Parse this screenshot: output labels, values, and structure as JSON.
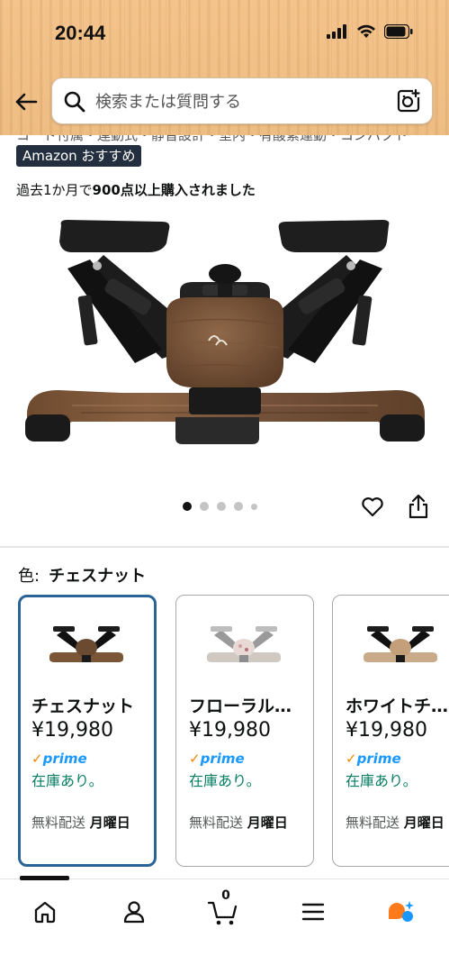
{
  "status_bar": {
    "time": "20:44"
  },
  "search": {
    "placeholder": "検索または質問する"
  },
  "cut_text": "コード付属・連動式・静音設計・室内・有酸素運動・コンパクト",
  "badge": {
    "label": "Amazon おすすめ"
  },
  "purchase": {
    "prefix": "過去1か月で",
    "bold": "900点以上購入されました"
  },
  "carousel": {
    "total": 5,
    "active": 0
  },
  "color": {
    "label": "色:",
    "value": "チェスナット"
  },
  "variants": [
    {
      "name": "チェスナット",
      "price": "¥19,980",
      "prime": "prime",
      "stock": "在庫あり。",
      "ship_label": "無料配送",
      "ship_day": "月曜日",
      "selected": true
    },
    {
      "name": "フローラル…",
      "price": "¥19,980",
      "prime": "prime",
      "stock": "在庫あり。",
      "ship_label": "無料配送",
      "ship_day": "月曜日",
      "selected": false
    },
    {
      "name": "ホワイトチ…",
      "price": "¥19,980",
      "prime": "prime",
      "stock": "在庫あり。",
      "ship_label": "無料配送",
      "ship_day": "月曜日",
      "selected": false
    }
  ],
  "tabbar": {
    "cart_count": "0"
  },
  "colors": {
    "accent_selected": "#2a6496",
    "in_stock": "#067d62",
    "prime_blue": "#1a98ff",
    "badge_bg": "#232f3e",
    "alexa": "#ff7a1a"
  },
  "icons": [
    "back-arrow-icon",
    "search-icon",
    "camera-icon",
    "heart-icon",
    "share-icon",
    "home-icon",
    "person-icon",
    "cart-icon",
    "menu-icon",
    "alexa-icon"
  ]
}
